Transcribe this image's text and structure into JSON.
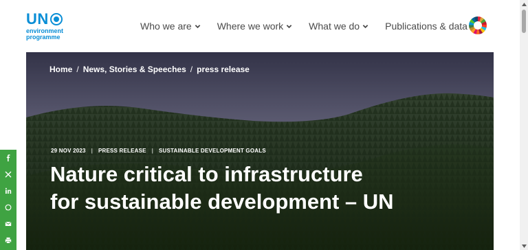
{
  "logo": {
    "line1": "UN",
    "line2": "environment",
    "line3": "programme"
  },
  "nav": {
    "items": [
      {
        "label": "Who we are",
        "dropdown": true
      },
      {
        "label": "Where we work",
        "dropdown": true
      },
      {
        "label": "What we do",
        "dropdown": true
      },
      {
        "label": "Publications & data",
        "dropdown": false
      }
    ]
  },
  "breadcrumb": [
    "Home",
    "News, Stories & Speeches",
    "press release"
  ],
  "article": {
    "date": "29 NOV 2023",
    "type": "PRESS RELEASE",
    "topic": "SUSTAINABLE DEVELOPMENT GOALS",
    "title": "Nature critical to infrastructure for sustainable development – UN"
  },
  "share": [
    "facebook-icon",
    "x-icon",
    "linkedin-icon",
    "whatsapp-icon",
    "email-icon",
    "print-icon"
  ],
  "colors": {
    "brand": "#0a8ed6",
    "share_green": "#3fa342",
    "nav_text": "#4a4a4a"
  }
}
